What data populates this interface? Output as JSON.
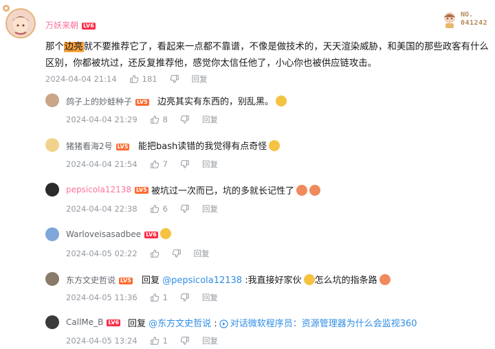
{
  "main_comment": {
    "user": "万妖来朝",
    "level": "LV6",
    "text_a": "那个",
    "highlight": "边亮",
    "text_b": "就不要推荐它了，看起来一点都不靠谱，不像是做技术的，天天渲染威胁，和美国的那些政客有什么",
    "line2": "区别，你都被坑过，还反复推荐他，感觉你太信任他了，小心你也被供应链攻击。",
    "time": "2024-04-04 21:14",
    "likes": "181",
    "reply_label": "回复",
    "badge_text_1": "NO.",
    "badge_text_2": "041242"
  },
  "replies": [
    {
      "user": "鸽子上的妙蛙种子",
      "level": "LV5",
      "text": "边亮其实有东西的，别乱黑。",
      "time": "2024-04-04 21:29",
      "likes": "8",
      "reply_label": "回复"
    },
    {
      "user": "猪猪看海2号",
      "level": "LV5",
      "text": "能把bash读错的我觉得有点奇怪",
      "time": "2024-04-04 21:54",
      "likes": "7",
      "reply_label": "回复"
    },
    {
      "user": "pepsicola12138",
      "level": "LV5",
      "text": "被坑过一次而已，坑的多就长记性了",
      "time": "2024-04-04 22:38",
      "likes": "6",
      "reply_label": "回复"
    },
    {
      "user": "Warloveisasadbee",
      "level": "LV6",
      "text": "",
      "time": "2024-04-05 02:22",
      "likes": "",
      "reply_label": "回复"
    },
    {
      "user": "东方文史哲说",
      "level": "LV5",
      "reply_prefix": "回复",
      "mention": "@pepsicola12138",
      "text_a": ":我直接好家伙",
      "text_b": "怎么坑的指条路",
      "time": "2024-04-05 11:36",
      "likes": "1",
      "reply_label": "回复"
    },
    {
      "user": "CallMe_B",
      "level": "LV6",
      "reply_prefix": "回复",
      "mention": "@东方文史哲说",
      "text_a": ":",
      "link_text": "对话微软程序员：资源管理器为什么会监视360",
      "time": "2024-04-05 13:24",
      "likes": "1",
      "reply_label": "回复"
    }
  ],
  "colors": {
    "username_pink": "#fb7299",
    "username_gray": "#61666d",
    "link_blue": "#2f8ce6",
    "meta_gray": "#9499a0",
    "highlight": "#f8a13b"
  },
  "icons": {
    "like": "thumb-up-icon",
    "dislike": "thumb-down-icon",
    "emoji": "emoji-icon",
    "link": "play-circle-icon"
  }
}
